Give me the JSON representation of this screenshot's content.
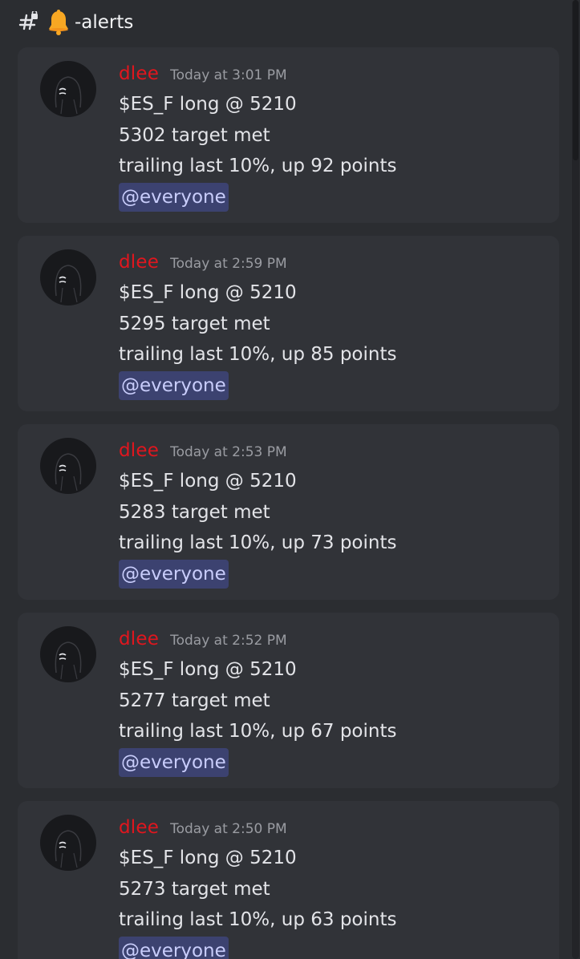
{
  "channel": {
    "hash_icon": "hash-lock-icon",
    "bell_icon": "bell-icon",
    "name": "-alerts"
  },
  "messages": [
    {
      "author": "dlee",
      "timestamp": "Today at 3:01 PM",
      "lines": [
        "$ES_F long @ 5210",
        "5302 target met",
        "trailing last 10%, up 92 points"
      ],
      "mention": "@everyone"
    },
    {
      "author": "dlee",
      "timestamp": "Today at 2:59 PM",
      "lines": [
        "$ES_F long @ 5210",
        "5295 target met",
        "trailing last 10%, up 85 points"
      ],
      "mention": "@everyone"
    },
    {
      "author": "dlee",
      "timestamp": "Today at 2:53 PM",
      "lines": [
        "$ES_F long @ 5210",
        "5283 target met",
        "trailing last 10%, up 73 points"
      ],
      "mention": "@everyone"
    },
    {
      "author": "dlee",
      "timestamp": "Today at 2:52 PM",
      "lines": [
        "$ES_F long @ 5210",
        "5277 target met",
        "trailing last 10%, up 67 points"
      ],
      "mention": "@everyone"
    },
    {
      "author": "dlee",
      "timestamp": "Today at 2:50 PM",
      "lines": [
        "$ES_F long @ 5210",
        "5273 target met",
        "trailing last 10%, up 63 points"
      ],
      "mention": "@everyone"
    }
  ],
  "colors": {
    "background": "#2b2d31",
    "card": "#313338",
    "author": "#e0161e",
    "timestamp": "#9a9ca2",
    "text": "#e3e4e8",
    "mention_bg": "#3c4270",
    "mention_text": "#c9cdfb"
  }
}
